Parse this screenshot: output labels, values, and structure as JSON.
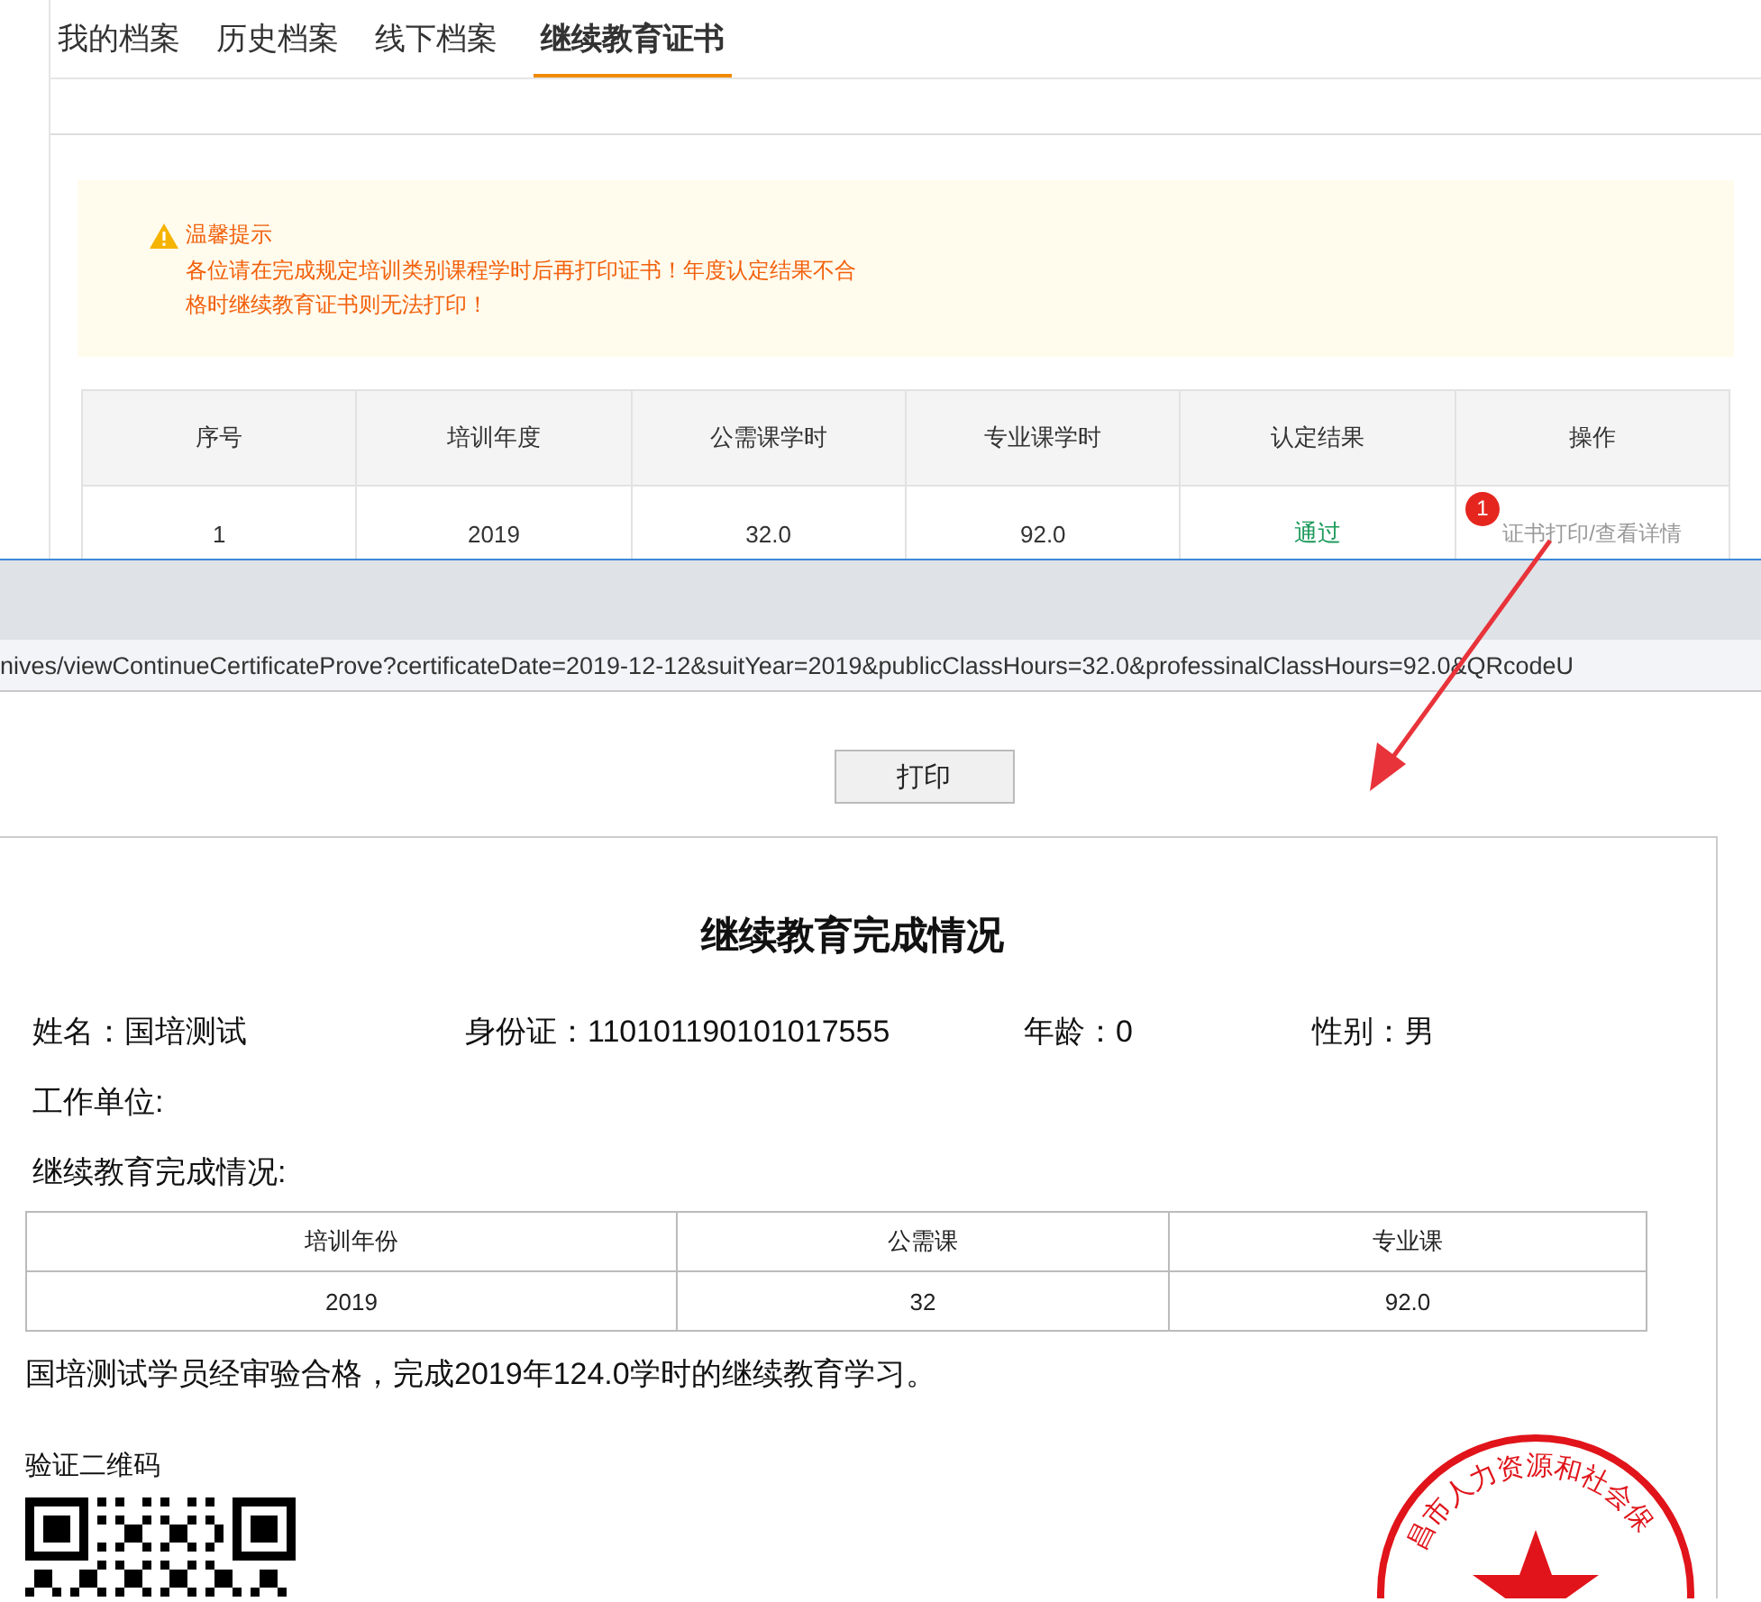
{
  "tabs": [
    {
      "label": "我的档案",
      "selected": false
    },
    {
      "label": "历史档案",
      "selected": false
    },
    {
      "label": "线下档案",
      "selected": false
    },
    {
      "label": "继续教育证书",
      "selected": true
    }
  ],
  "notice": {
    "title": "温馨提示",
    "text": "各位请在完成规定培训类别课程学时后再打印证书！年度认定结果不合格时继续教育证书则无法打印！"
  },
  "records_table": {
    "columns": [
      "序号",
      "培训年度",
      "公需课学时",
      "专业课学时",
      "认定结果",
      "操作"
    ],
    "rows": [
      {
        "cells": [
          {
            "kind": "plain",
            "text": "1"
          },
          {
            "kind": "plain",
            "text": "2019"
          },
          {
            "kind": "plain",
            "text": "32.0"
          },
          {
            "kind": "plain",
            "text": "92.0"
          },
          {
            "kind": "result",
            "text": "通过"
          },
          {
            "kind": "action",
            "text": "证书打印/查看详情"
          }
        ]
      }
    ]
  },
  "annotation": {
    "badge": "1"
  },
  "popup": {
    "url": "nives/viewContinueCertificateProve?certificateDate=2019-12-12&suitYear=2019&publicClassHours=32.0&professinalClassHours=92.0&QRcodeU",
    "print_button": "打印",
    "certificate": {
      "title": "继续教育完成情况",
      "fields": [
        "姓名：国培测试",
        "身份证：110101190101017555",
        "年龄：0",
        "性别：男"
      ],
      "work_unit_label": "工作单位:",
      "section_label": "继续教育完成情况:",
      "table": {
        "columns": [
          "培训年份",
          "公需课",
          "专业课"
        ],
        "rows": [
          [
            "2019",
            "32",
            "92.0"
          ]
        ]
      },
      "statement": "国培测试学员经审验合格，完成2019年124.0学时的继续教育学习。",
      "qr_label": "验证二维码",
      "seal_text": "昌市人力资源和社会保"
    }
  }
}
